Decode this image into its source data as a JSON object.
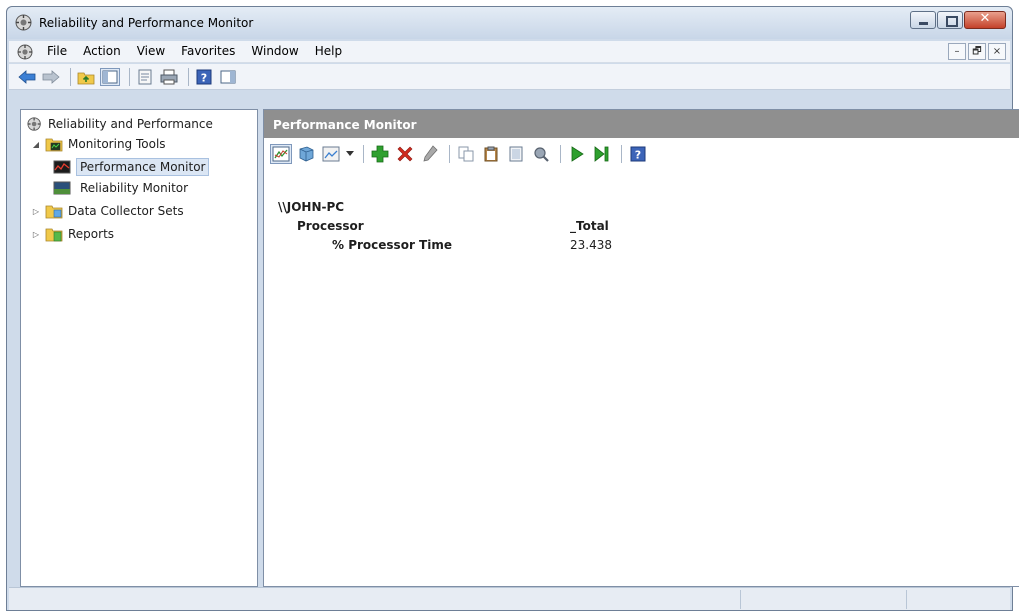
{
  "window": {
    "title": "Reliability and Performance Monitor",
    "close_glyph": "✕"
  },
  "menubar": {
    "items": [
      "File",
      "Action",
      "View",
      "Favorites",
      "Window",
      "Help"
    ]
  },
  "mdi_buttons": {
    "minimize": "–",
    "restore": "🗗",
    "close": "×"
  },
  "toolbar": {
    "icons": [
      "back-arrow-icon",
      "forward-arrow-icon",
      "up-folder-icon",
      "show-hide-console-tree-icon",
      "properties-icon",
      "print-icon",
      "help-icon",
      "show-hide-action-pane-icon"
    ]
  },
  "tree": {
    "root": "Reliability and Performance",
    "items": [
      {
        "label": "Monitoring Tools",
        "expanded": true
      },
      {
        "label": "Performance Monitor",
        "selected": true
      },
      {
        "label": "Reliability Monitor"
      },
      {
        "label": "Data Collector Sets",
        "expanded": false
      },
      {
        "label": "Reports",
        "expanded": false
      }
    ]
  },
  "right_pane": {
    "header": "Performance Monitor",
    "toolbar_icons": [
      "view-graph-icon",
      "freeze-display-icon",
      "change-graph-type-icon",
      "dropdown-arrow-icon",
      "add-counter-icon",
      "delete-counter-icon",
      "highlight-icon",
      "copy-properties-icon",
      "paste-counter-list-icon",
      "properties-icon",
      "zoom-icon",
      "update-data-icon",
      "next-sample-icon",
      "help-icon"
    ],
    "report": {
      "machine": "\\\\JOHN-PC",
      "object": "Processor",
      "instance": "_Total",
      "counter": "% Processor Time",
      "value": "23.438"
    }
  },
  "colors": {
    "pane_header": "#8f8f8f",
    "frame": "#cfdbea",
    "add_green": "#2ea02e",
    "delete_red": "#d12b1f"
  }
}
